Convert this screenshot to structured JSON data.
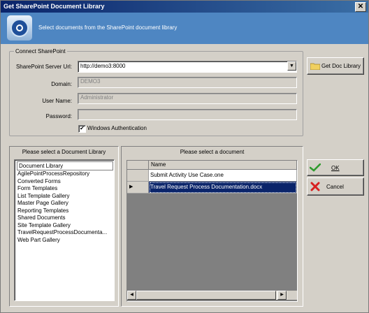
{
  "window": {
    "title": "Get SharePoint Document Library",
    "close_glyph": "✕"
  },
  "banner": {
    "icon": "sharepoint-logo-icon",
    "text": "Select documents from the SharePoint document library"
  },
  "connect": {
    "legend": "Connect SharePoint",
    "server_url_label": "SharePoint Server Url:",
    "server_url_value": "http://demo3:8000",
    "domain_label": "Domain:",
    "domain_value": "DEMO3",
    "username_label": "User Name:",
    "username_value": "Administrator",
    "password_label": "Password:",
    "password_value": "",
    "windows_auth_label": "Windows Authentication",
    "windows_auth_checked": true,
    "check_glyph": "✔",
    "get_doc_library_label": "Get Doc Library"
  },
  "library_panel": {
    "heading": "Please select a Document Library",
    "column_header": "Document Library",
    "items": [
      "AgilePointProcessRepository",
      "Converted Forms",
      "Form Templates",
      "List Template Gallery",
      "Master Page Gallery",
      "Reporting Templates",
      "Shared Documents",
      "Site Template Gallery",
      "TravelRequestProcessDocumenta...",
      "Web Part Gallery"
    ]
  },
  "document_panel": {
    "heading": "Please select a document",
    "column_header": "Name",
    "rows": [
      {
        "name": "Submit Activity Use Case.one",
        "selected": false
      },
      {
        "name": "Travel Request Process Documentation.docx",
        "selected": true
      }
    ],
    "row_pointer_glyph": "▶"
  },
  "actions": {
    "ok_label": "OK",
    "cancel_label": "Cancel"
  },
  "colors": {
    "title_bar": "#0a246a",
    "banner": "#4e86c2",
    "selection": "#0a246a",
    "dialog_bg": "#d4d0c8",
    "ok_icon": "#2e9b2e",
    "cancel_icon": "#d82020"
  }
}
